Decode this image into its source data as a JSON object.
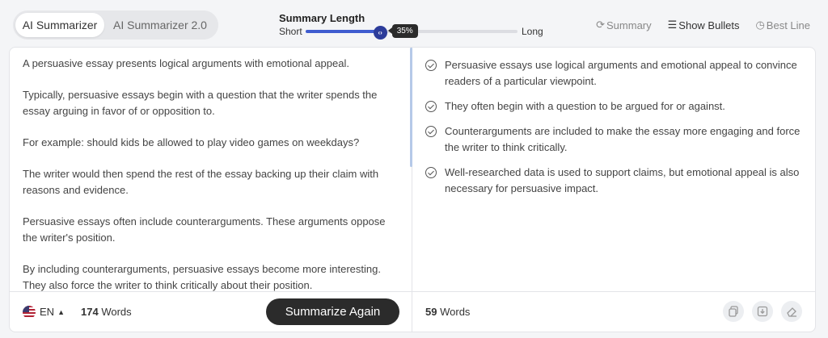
{
  "tabs": [
    {
      "label": "AI Summarizer",
      "active": true
    },
    {
      "label": "AI Summarizer 2.0",
      "active": false
    }
  ],
  "summary_length": {
    "title": "Summary Length",
    "min_label": "Short",
    "max_label": "Long",
    "value_percent": 35,
    "value_label": "35%"
  },
  "modes": [
    {
      "label": "Summary",
      "icon": "summary-icon",
      "active": false
    },
    {
      "label": "Show Bullets",
      "icon": "bullets-icon",
      "active": true
    },
    {
      "label": "Best Line",
      "icon": "best-line-icon",
      "active": false
    }
  ],
  "input": {
    "paragraphs": [
      "A persuasive essay presents logical arguments with emotional appeal.",
      "Typically, persuasive essays begin with a question that the writer spends the essay arguing in favor of or opposition to.",
      "For example: should kids be allowed to play video games on weekdays?",
      "The writer would then spend the rest of the essay backing up their claim with reasons and evidence.",
      "Persuasive essays often include counterarguments. These arguments oppose the writer's position.",
      "By including counterarguments, persuasive essays become more interesting. They also force the writer to think critically about their position."
    ],
    "language": "EN",
    "word_count": "174",
    "word_label": "Words",
    "button_label": "Summarize Again"
  },
  "output": {
    "bullets": [
      "Persuasive essays use logical arguments and emotional appeal to convince readers of a particular viewpoint.",
      "They often begin with a question to be argued for or against.",
      "Counterarguments are included to make the essay more engaging and force the writer to think critically.",
      "Well-researched data is used to support claims, but emotional appeal is also necessary for persuasive impact."
    ],
    "word_count": "59",
    "word_label": "Words"
  },
  "colors": {
    "accent": "#3f5ccf",
    "thumb": "#2c3c9a",
    "button": "#2b2b2b"
  }
}
